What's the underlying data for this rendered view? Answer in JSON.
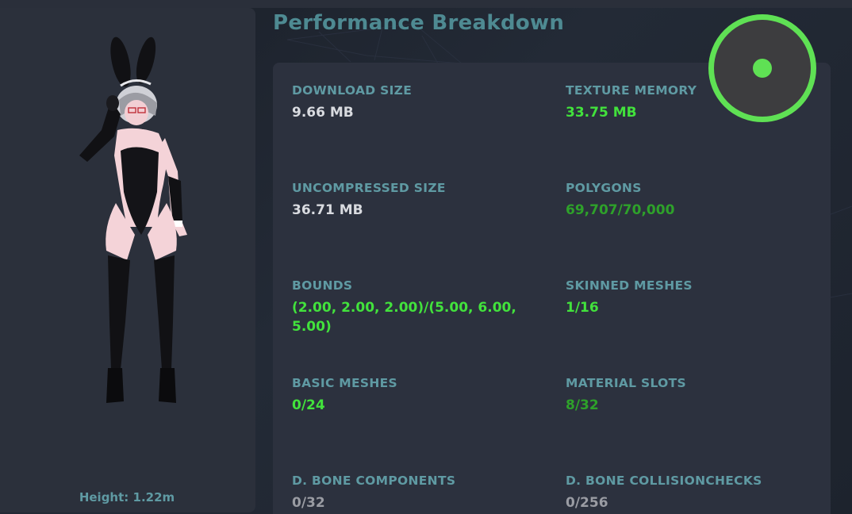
{
  "title": "Performance Breakdown",
  "avatar": {
    "height_label": "Height: 1.22m"
  },
  "status": {
    "color": "#5fe154",
    "icon": "status-ring-icon"
  },
  "stats": {
    "download_size": {
      "label": "DOWNLOAD SIZE",
      "value": "9.66 MB"
    },
    "texture_memory": {
      "label": "TEXTURE MEMORY",
      "value": "33.75 MB"
    },
    "uncompressed_size": {
      "label": "UNCOMPRESSED SIZE",
      "value": "36.71 MB"
    },
    "polygons": {
      "label": "POLYGONS",
      "value": "69,707/70,000"
    },
    "bounds": {
      "label": "BOUNDS",
      "value": "(2.00, 2.00, 2.00)/(5.00, 6.00, 5.00)"
    },
    "skinned_meshes": {
      "label": "SKINNED MESHES",
      "value": "1/16"
    },
    "basic_meshes": {
      "label": "BASIC MESHES",
      "value": "0/24"
    },
    "material_slots": {
      "label": "MATERIAL SLOTS",
      "value": "8/32"
    },
    "dbone_components": {
      "label": "D. BONE COMPONENTS",
      "value": "0/32"
    },
    "dbone_collisionchecks": {
      "label": "D. BONE COLLISIONCHECKS",
      "value": "0/256"
    }
  },
  "colors": {
    "label": "#5f9aa3",
    "value_white": "#d9dbe0",
    "value_good": "#42e23c",
    "value_medium": "#2ea12a",
    "value_none": "#9a9ca3"
  }
}
